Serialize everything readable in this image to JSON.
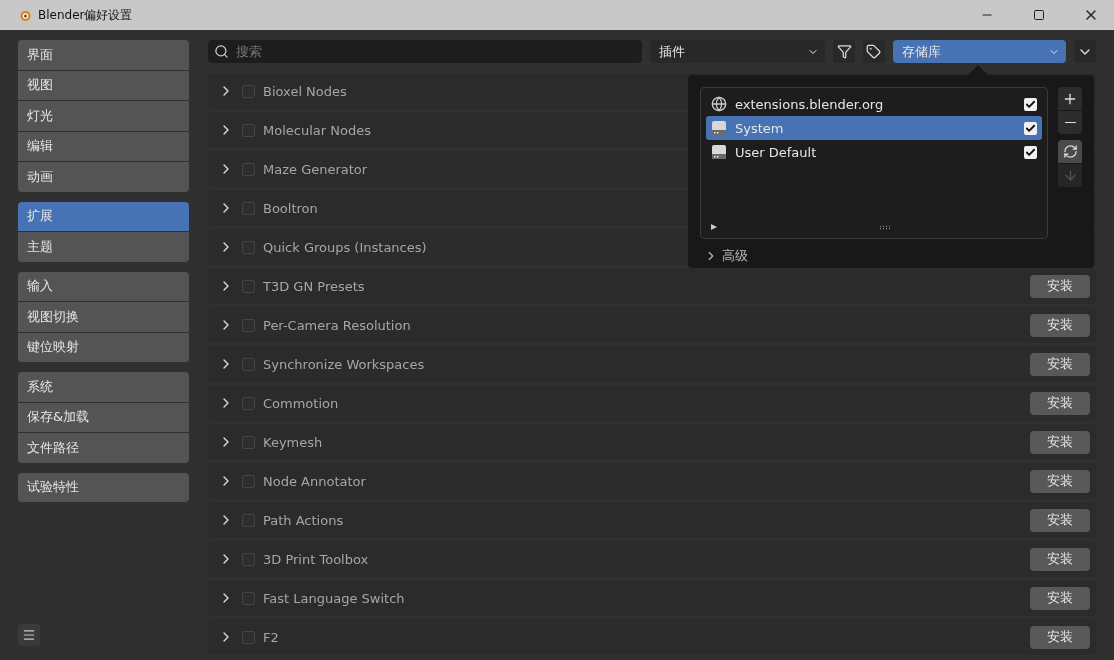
{
  "window": {
    "title": "Blender偏好设置"
  },
  "sidebar": {
    "groups": [
      [
        {
          "label": "界面",
          "selected": false
        },
        {
          "label": "视图",
          "selected": false
        },
        {
          "label": "灯光",
          "selected": false
        },
        {
          "label": "编辑",
          "selected": false
        },
        {
          "label": "动画",
          "selected": false
        }
      ],
      [
        {
          "label": "扩展",
          "selected": true
        },
        {
          "label": "主题",
          "selected": false
        }
      ],
      [
        {
          "label": "输入",
          "selected": false
        },
        {
          "label": "视图切换",
          "selected": false
        },
        {
          "label": "键位映射",
          "selected": false
        }
      ],
      [
        {
          "label": "系统",
          "selected": false
        },
        {
          "label": "保存&加载",
          "selected": false
        },
        {
          "label": "文件路径",
          "selected": false
        }
      ],
      [
        {
          "label": "试验特性",
          "selected": false
        }
      ]
    ]
  },
  "search": {
    "placeholder": "搜索"
  },
  "type_filter": {
    "value": "插件"
  },
  "repo_select": {
    "value": "存储库"
  },
  "extensions": [
    {
      "name": "Bioxel Nodes",
      "enabled": false
    },
    {
      "name": "Molecular Nodes",
      "enabled": false
    },
    {
      "name": "Maze Generator",
      "enabled": false
    },
    {
      "name": "Booltron",
      "enabled": false
    },
    {
      "name": "Quick Groups (Instances)",
      "enabled": false
    },
    {
      "name": "T3D GN Presets",
      "enabled": false,
      "action": "安装"
    },
    {
      "name": "Per-Camera Resolution",
      "enabled": false,
      "action": "安装"
    },
    {
      "name": "Synchronize Workspaces",
      "enabled": false,
      "action": "安装"
    },
    {
      "name": "Commotion",
      "enabled": false,
      "action": "安装"
    },
    {
      "name": "Keymesh",
      "enabled": false,
      "action": "安装"
    },
    {
      "name": "Node Annotator",
      "enabled": false,
      "action": "安装"
    },
    {
      "name": "Path Actions",
      "enabled": false,
      "action": "安装"
    },
    {
      "name": "3D Print Toolbox",
      "enabled": false,
      "action": "安装"
    },
    {
      "name": "Fast Language Switch",
      "enabled": false,
      "action": "安装"
    },
    {
      "name": "F2",
      "enabled": false,
      "action": "安装"
    }
  ],
  "repositories_popup": {
    "repositories": [
      {
        "name": "extensions.blender.org",
        "kind": "remote",
        "checked": true,
        "selected": false
      },
      {
        "name": "System",
        "kind": "local",
        "checked": true,
        "selected": true
      },
      {
        "name": "User Default",
        "kind": "local",
        "checked": true,
        "selected": false
      }
    ],
    "advanced": {
      "label": "高级",
      "expanded": false
    }
  }
}
